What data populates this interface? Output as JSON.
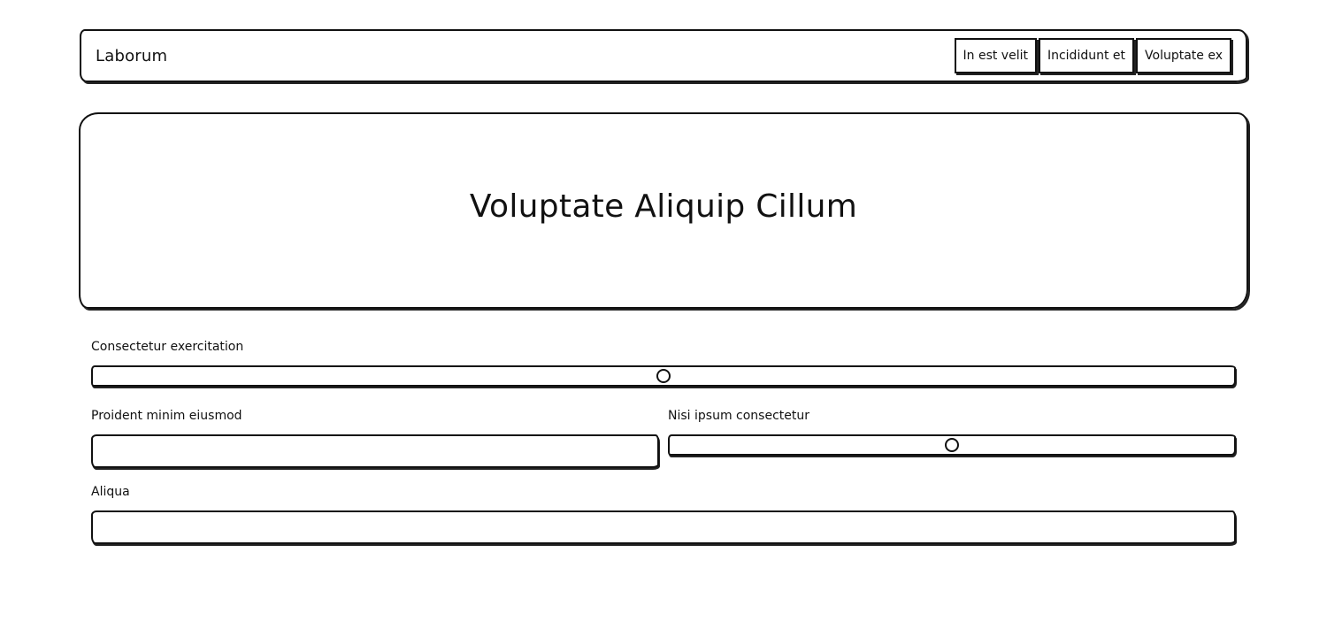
{
  "header": {
    "brand": "Laborum",
    "nav": [
      {
        "label": "In est velit"
      },
      {
        "label": "Incididunt et"
      },
      {
        "label": "Voluptate ex"
      }
    ]
  },
  "hero": {
    "title": "Voluptate Aliquip Cillum"
  },
  "form": {
    "slider1": {
      "label": "Consectetur exercitation",
      "value_percent": 50
    },
    "input1": {
      "label": "Proident minim eiusmod",
      "value": "",
      "placeholder": ""
    },
    "slider2": {
      "label": "Nisi ipsum consectetur",
      "value_percent": 50
    },
    "input2": {
      "label": "Aliqua",
      "value": "",
      "placeholder": ""
    }
  }
}
